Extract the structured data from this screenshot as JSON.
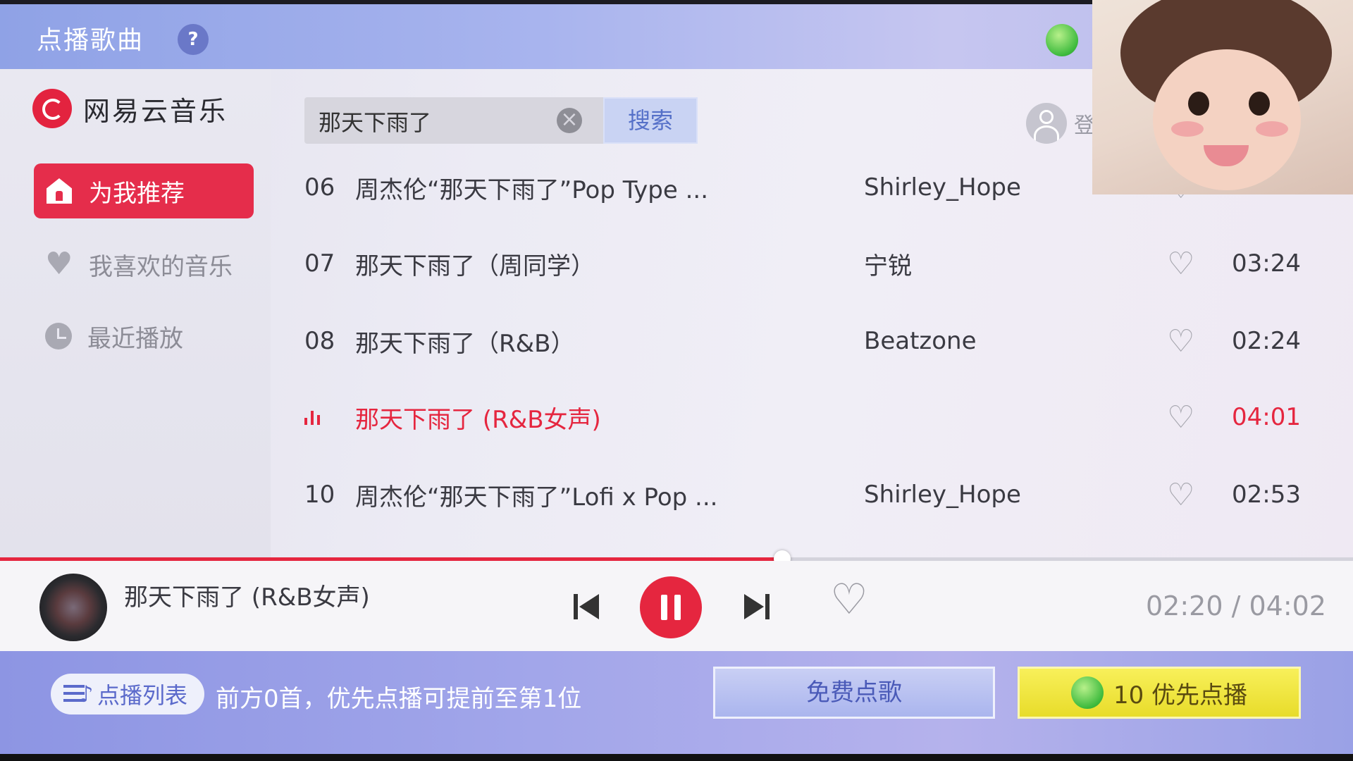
{
  "header": {
    "title": "点播歌曲",
    "help_label": "?"
  },
  "brand": {
    "name": "网易云音乐"
  },
  "sidebar": {
    "items": [
      {
        "label": "为我推荐",
        "active": true,
        "icon": "home-icon"
      },
      {
        "label": "我喜欢的音乐",
        "active": false,
        "icon": "heart-icon"
      },
      {
        "label": "最近播放",
        "active": false,
        "icon": "clock-icon"
      }
    ]
  },
  "search": {
    "value": "那天下雨了",
    "button_label": "搜索",
    "clear_icon": "clear-icon"
  },
  "login": {
    "label": "登"
  },
  "songs": [
    {
      "num": "06",
      "title": "周杰伦“那天下雨了”Pop Type ...",
      "artist": "Shirley_Hope",
      "duration": "",
      "playing": false
    },
    {
      "num": "07",
      "title": "那天下雨了（周同学）",
      "artist": "宁锐",
      "duration": "03:24",
      "playing": false
    },
    {
      "num": "08",
      "title": "那天下雨了（R&B）",
      "artist": "Beatzone",
      "duration": "02:24",
      "playing": false
    },
    {
      "num": "",
      "title": "那天下雨了 (R&B女声)",
      "artist": "",
      "duration": "04:01",
      "playing": true
    },
    {
      "num": "10",
      "title": "周杰伦“那天下雨了”Lofi x Pop ...",
      "artist": "Shirley_Hope",
      "duration": "02:53",
      "playing": false
    }
  ],
  "player": {
    "title": "那天下雨了 (R&B女声)",
    "current_time": "02:20",
    "separator": " / ",
    "total_time": "04:02",
    "progress": 0.578,
    "time_display": "02:20 / 04:02"
  },
  "bottom": {
    "queue_label": "点播列表",
    "queue_info": "前方0首，优先点播可提前至第1位",
    "free_label": "免费点歌",
    "priority_label": "10 优先点播"
  },
  "colors": {
    "accent": "#e5263f",
    "brand": "#e3233f",
    "bottom_bar": "#a2a6ea",
    "priority": "#f0e640"
  }
}
